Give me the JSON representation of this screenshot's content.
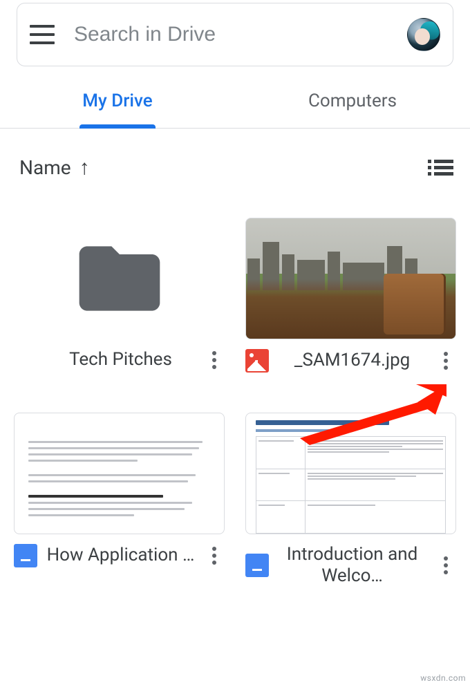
{
  "search": {
    "placeholder": "Search in Drive"
  },
  "tabs": {
    "my_drive": "My Drive",
    "computers": "Computers"
  },
  "sort": {
    "label": "Name",
    "direction": "↑"
  },
  "items": [
    {
      "label": "Tech Pitches",
      "type": "folder"
    },
    {
      "label": "_SAM1674.jpg",
      "type": "image"
    },
    {
      "label": "How Application …",
      "type": "gdoc"
    },
    {
      "label": "Introduction and Welco…",
      "type": "gdoc"
    }
  ],
  "watermark": "wsxdn.com"
}
